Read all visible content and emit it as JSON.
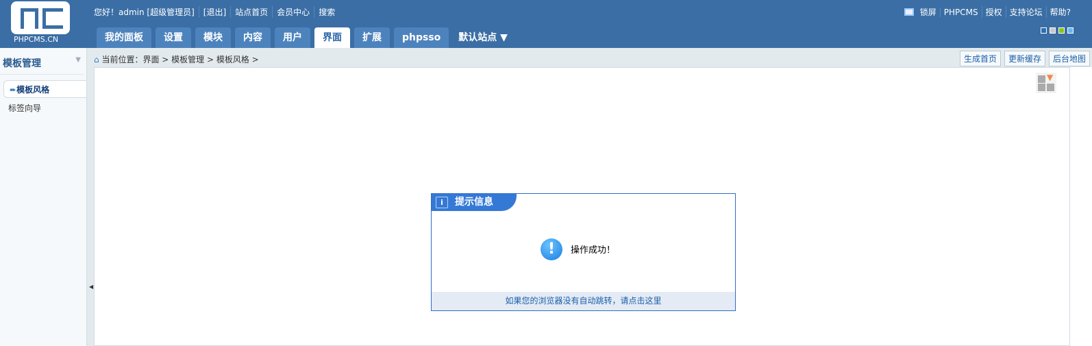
{
  "logo": {
    "text": "PHPCMS.CN"
  },
  "topnav": {
    "greeting": "您好！admin [超级管理员]",
    "logout": "[退出]",
    "site_home": "站点首页",
    "member": "会员中心",
    "search": "搜索"
  },
  "topright": {
    "lock": "锁屏",
    "phpcms": "PHPCMS",
    "license": "授权",
    "forum": "支持论坛",
    "help": "帮助?"
  },
  "swatches": [
    "#2a6fb0",
    "#c8c8c8",
    "#8cc21b",
    "#6bb6ec"
  ],
  "tabs": [
    {
      "label": "我的面板"
    },
    {
      "label": "设置"
    },
    {
      "label": "模块"
    },
    {
      "label": "内容"
    },
    {
      "label": "用户"
    },
    {
      "label": "界面",
      "active": true
    },
    {
      "label": "扩展"
    },
    {
      "label": "phpsso"
    }
  ],
  "site_select": "默认站点",
  "sidebar": {
    "title": "模板管理",
    "items": [
      {
        "label": "模板风格",
        "active": true
      },
      {
        "label": "标签向导"
      }
    ]
  },
  "breadcrumb": {
    "prefix": "当前位置：",
    "path": "界面 > 模板管理 > 模板风格 >"
  },
  "actions": {
    "gen_home": "生成首页",
    "update_cache": "更新缓存",
    "sitemap": "后台地图"
  },
  "message": {
    "title": "提示信息",
    "text": "操作成功！",
    "redirect": "如果您的浏览器没有自动跳转，请点击这里"
  }
}
